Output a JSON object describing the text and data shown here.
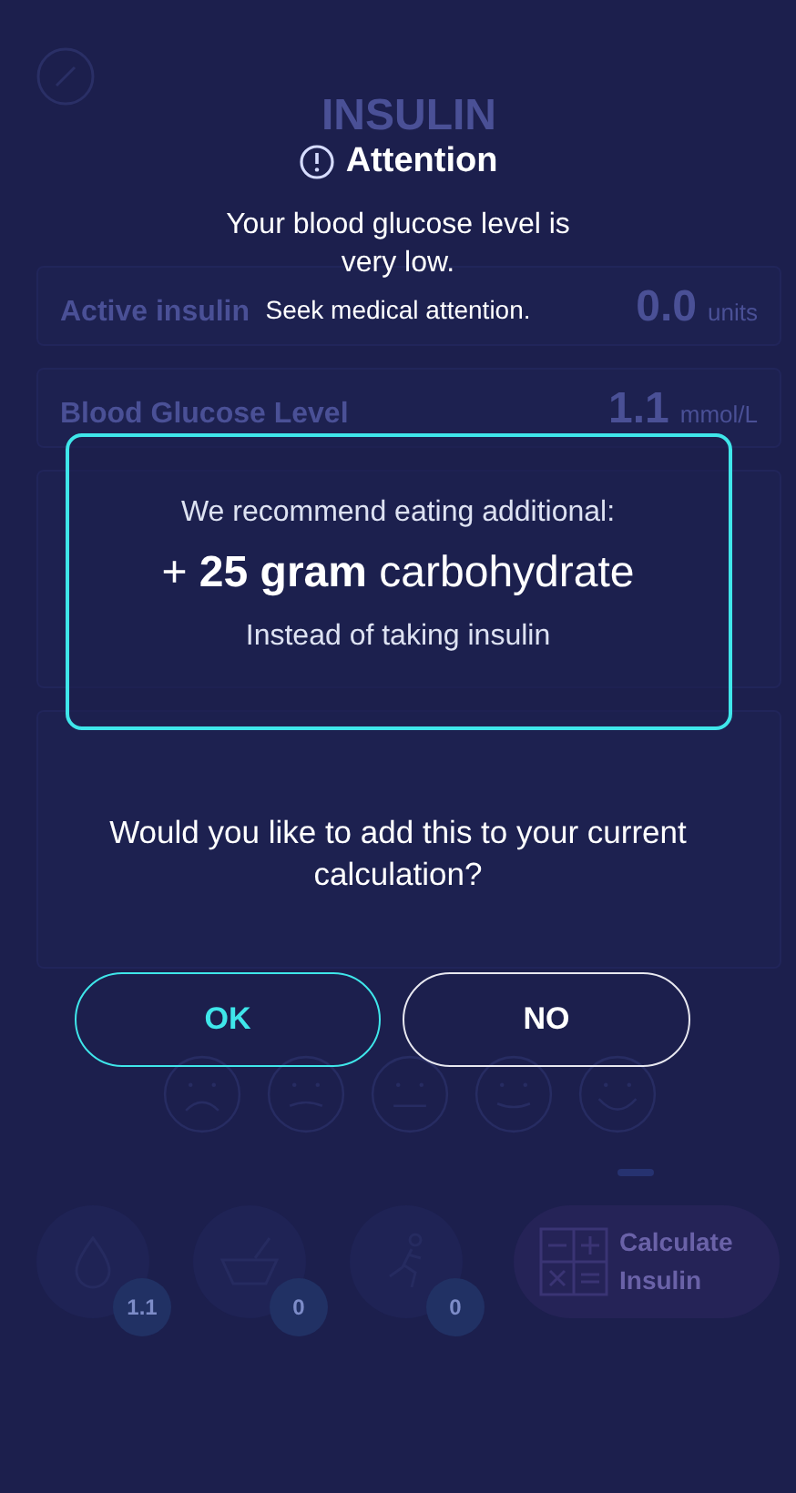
{
  "background": {
    "title": "INSULIN",
    "active_insulin": {
      "label": "Active insulin",
      "value": "0.0",
      "unit": "units"
    },
    "blood_glucose": {
      "label": "Blood Glucose Level",
      "value": "1.1",
      "unit": "mmol/L"
    },
    "faces": [
      {
        "kind": "sad"
      },
      {
        "kind": "unsure"
      },
      {
        "kind": "neutral"
      },
      {
        "kind": "content"
      },
      {
        "kind": "happy"
      }
    ],
    "bottom_buttons": [
      {
        "kind": "drop",
        "badge": "1.1"
      },
      {
        "kind": "food",
        "badge": "0"
      },
      {
        "kind": "exercise",
        "badge": "0"
      }
    ],
    "calculate_button": "Calculate Insulin"
  },
  "dialog": {
    "title": "Attention",
    "message": "Your blood glucose level is very low.",
    "note": "Seek medical attention.",
    "recommendation": {
      "intro": "We recommend eating additional:",
      "amount": "+ **25 gram** carbohydrate",
      "subtext": "Instead of taking insulin"
    },
    "question": "Would you like to add this to your current calculation?",
    "buttons": [
      {
        "kind": "primary",
        "label": "OK"
      },
      {
        "kind": "secondary",
        "label": "NO"
      }
    ]
  }
}
